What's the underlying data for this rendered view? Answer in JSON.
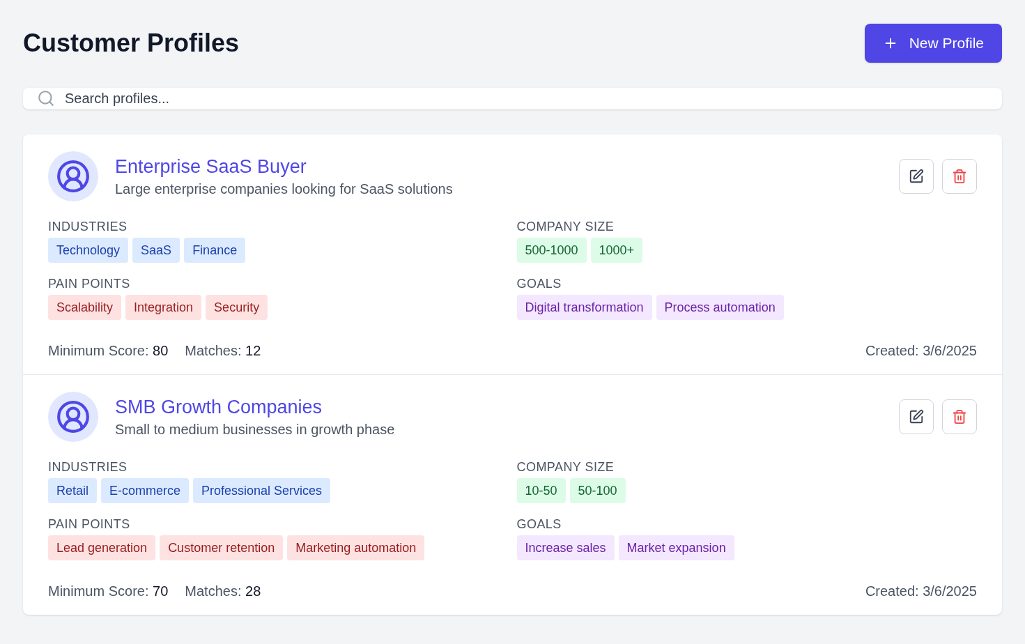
{
  "header": {
    "title": "Customer Profiles",
    "new_button": "New Profile"
  },
  "search": {
    "placeholder": "Search profiles..."
  },
  "profiles": [
    {
      "name": "Enterprise SaaS Buyer",
      "description": "Large enterprise companies looking for SaaS solutions",
      "sections": [
        {
          "kind": "industries",
          "label": "INDUSTRIES",
          "tags": [
            "Technology",
            "SaaS",
            "Finance"
          ]
        },
        {
          "kind": "company_size",
          "label": "COMPANY SIZE",
          "tags": [
            "500-1000",
            "1000+"
          ]
        },
        {
          "kind": "pain_points",
          "label": "PAIN POINTS",
          "tags": [
            "Scalability",
            "Integration",
            "Security"
          ]
        },
        {
          "kind": "goals",
          "label": "GOALS",
          "tags": [
            "Digital transformation",
            "Process automation"
          ]
        }
      ],
      "min_score_label": "Minimum Score:",
      "min_score": "80",
      "matches_label": "Matches:",
      "matches": "12",
      "created": "Created: 3/6/2025"
    },
    {
      "name": "SMB Growth Companies",
      "description": "Small to medium businesses in growth phase",
      "sections": [
        {
          "kind": "industries",
          "label": "INDUSTRIES",
          "tags": [
            "Retail",
            "E-commerce",
            "Professional Services"
          ]
        },
        {
          "kind": "company_size",
          "label": "COMPANY SIZE",
          "tags": [
            "10-50",
            "50-100"
          ]
        },
        {
          "kind": "pain_points",
          "label": "PAIN POINTS",
          "tags": [
            "Lead generation",
            "Customer retention",
            "Marketing automation"
          ]
        },
        {
          "kind": "goals",
          "label": "GOALS",
          "tags": [
            "Increase sales",
            "Market expansion"
          ]
        }
      ],
      "min_score_label": "Minimum Score:",
      "min_score": "70",
      "matches_label": "Matches:",
      "matches": "28",
      "created": "Created: 3/6/2025"
    }
  ]
}
